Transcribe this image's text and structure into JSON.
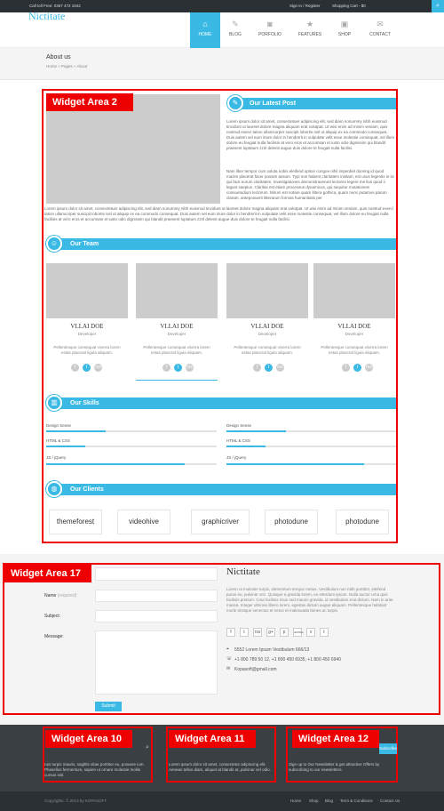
{
  "topbar": {
    "phone": "Call toll Free: 0367 472 1942",
    "signin": "Sign In / Register",
    "cart": "Shopping Cart - $0"
  },
  "header": {
    "logo": "Nictitate",
    "nav": [
      {
        "label": "HOME",
        "icon": "home-icon"
      },
      {
        "label": "BLOG",
        "icon": "pencil-icon"
      },
      {
        "label": "PORFOLIO",
        "icon": "camera-icon"
      },
      {
        "label": "FEATURES",
        "icon": "star-icon"
      },
      {
        "label": "SHOP",
        "icon": "bag-icon"
      },
      {
        "label": "CONTACT",
        "icon": "mail-icon"
      }
    ]
  },
  "breadcrumb": {
    "title": "About us",
    "path": "Home  »  Pages  »  About"
  },
  "widget_area_2": {
    "label": "Widget Area 2",
    "latest_post": {
      "title": "Our Latest Post",
      "p1": "Lorem ipsum dolor sit amet, consectetuer adipiscing elit, sed diam nonummy nibh euismod tincidunt ut laoreet dolore magna aliquam erat volutpat. Ut wisi enim ad minim veniam, quis nostrud exerci tation ullamcorper suscipit lobortis nisl ut aliquip ex ea commodo consequat. Duis autem vel eum iriure dolor in hendrerit in vulputate velit esse molestie consequat, vel illum dolore eu feugiat nulla facilisis at vero eros et accumsan et iusto odio dignissim qui blandit praesent luptatum zzril delenit augue duis dolore te feugait nulla facilisi.",
      "p2": "Nam liber tempor cum soluta nobis eleifend option congue nihil imperdiet doming id quod mazim placerat facer possim assum. Typi non habent claritatem insitam; est usus legentis in iis qui facit eorum claritatem. Investigationes demonstraverunt lectores legere me lius quod ii legunt saepius. Claritas est etiam processus dynamicus, qui sequitur mutationem consuetudium lectorum. Mirum est notare quam littera gothica, quam nunc putamus parum claram, anteposuerit litterarum formas humanitatis per",
      "p3": "Lorem ipsum dolor sit amet, consectetuer adipiscing elit, sed diam nonummy nibh euismod tincidunt ut laoreet dolore magna aliquam erat volutpat. Ut wisi enim ad minim veniam, quis nostrud exerci tation ullamcorper suscipit lobortis nisl ut aliquip ex ea commodo consequat. Duis autem vel eum iriure dolor in hendrerit in vulputate velit esse molestie consequat, vel illum dolore eu feugiat nulla facilisis at vero eros et accumsan et iusto odio dignissim qui blandit praesent luptatum zzril delenit augue duis dolore te feugait nulla facilisi."
    },
    "team": {
      "title": "Our Team",
      "members": [
        {
          "name": "VLLAI DOE",
          "role": "Developer",
          "desc": "Pellentesque consequat viverra lorem estas placerat ligula aliquam."
        },
        {
          "name": "VLLAI DOE",
          "role": "Developer",
          "desc": "Pellentesque consequat viverra lorem estas placerat ligula aliquam."
        },
        {
          "name": "VLLAI DOE",
          "role": "Developer",
          "desc": "Pellentesque consequat viverra lorem estas placerat ligula aliquam."
        },
        {
          "name": "VLLAI DOE",
          "role": "Developer",
          "desc": "Pellentesque consequat viverra lorem estas placerat ligula aliquam."
        }
      ],
      "social": [
        "f",
        "t",
        "rss"
      ]
    },
    "skills": {
      "title": "Our Skills",
      "items": [
        {
          "label": "Design Sense",
          "level": 0.35
        },
        {
          "label": "Design Sense",
          "level": 0.35
        },
        {
          "label": "HTML & CSS",
          "level": 0.23
        },
        {
          "label": "HTML & CSS",
          "level": 0.23
        },
        {
          "label": "JS / jQuery",
          "level": 0.81
        },
        {
          "label": "JS / jQuery",
          "level": 0.81
        }
      ]
    },
    "clients": {
      "title": "Our Clients",
      "items": [
        "themeforest",
        "videohive",
        "graphicriver",
        "photodune",
        "photodune"
      ]
    }
  },
  "widget_area_17": {
    "label": "Widget Area 17",
    "form": {
      "name_label": "Name",
      "name_required": "(required)",
      "subject_label": "Subject:",
      "message_label": "Message:",
      "submit": "Submit"
    },
    "about": {
      "title": "Nictitate",
      "text": "Lorem ut molestie turpis, elementum tempor metus. Vestibulum non nibh porttitor, eleifend purus eu, pulvinar orci. Quisque a gravida lorem, eu interdum ipsum. Nulla auctor urna quis facilisis pretium. Cras facilisis risus sed mauris gravida, id vestibulum erat dictum. Nam in ante massa. Integer ultricies libero lorem, egestas dictum augue aliquam. Pellentesque habitant morbi tristique senectus et netus et malesuada fames ac turpis.",
      "social": [
        "f",
        "t",
        "rss",
        "g+",
        "p",
        "dribbble",
        "v",
        "t"
      ],
      "address": "5552 Lorem Ipsum Vestibulum 666/13",
      "phone": "+1 800 789 50 12, +1 800 450 6935, +1 800 450 6940",
      "email": "Kopasoft@gmail.com"
    }
  },
  "footer": {
    "w10": {
      "label": "Widget Area 10",
      "text": "ruis turpis mauris, sagittis vitae porttitor eu, posuere ium. Phasellus fermentum, sapien ut ornare molestie mollis cursus nisl."
    },
    "w11": {
      "label": "Widget Area 11",
      "text": "Lorem ipsum dolor sit amet, consectetur adipiscing elit. Aenean tellus diam, aliquet at blandit at, pulvinar vel odio."
    },
    "w12": {
      "label": "Widget Area 12",
      "subscribe": "Subscribe",
      "text": "Sign up to Our Newsletter & get attractive Offers by subscribing to our newsletters."
    },
    "copyright": "Copyrights. © 2013 by KOPASOFT",
    "links": [
      "Home",
      "Shop",
      "Blog",
      "Term & Conditions",
      "Contact Us"
    ]
  }
}
